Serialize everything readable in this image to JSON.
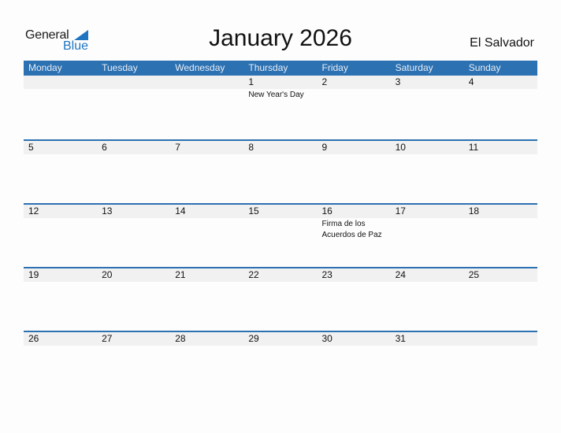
{
  "logo": {
    "line1": "General",
    "line2": "Blue"
  },
  "title": "January 2026",
  "country": "El Salvador",
  "colors": {
    "accent": "#2c71b2",
    "strip": "#f1f1f1",
    "logo_blue": "#1f74c1"
  },
  "weekdays": [
    "Monday",
    "Tuesday",
    "Wednesday",
    "Thursday",
    "Friday",
    "Saturday",
    "Sunday"
  ],
  "weeks": [
    [
      {
        "day": ""
      },
      {
        "day": ""
      },
      {
        "day": ""
      },
      {
        "day": "1",
        "holiday": "New Year's Day"
      },
      {
        "day": "2"
      },
      {
        "day": "3"
      },
      {
        "day": "4"
      }
    ],
    [
      {
        "day": "5"
      },
      {
        "day": "6"
      },
      {
        "day": "7"
      },
      {
        "day": "8"
      },
      {
        "day": "9"
      },
      {
        "day": "10"
      },
      {
        "day": "11"
      }
    ],
    [
      {
        "day": "12"
      },
      {
        "day": "13"
      },
      {
        "day": "14"
      },
      {
        "day": "15"
      },
      {
        "day": "16",
        "holiday": "Firma de los Acuerdos de Paz"
      },
      {
        "day": "17"
      },
      {
        "day": "18"
      }
    ],
    [
      {
        "day": "19"
      },
      {
        "day": "20"
      },
      {
        "day": "21"
      },
      {
        "day": "22"
      },
      {
        "day": "23"
      },
      {
        "day": "24"
      },
      {
        "day": "25"
      }
    ],
    [
      {
        "day": "26"
      },
      {
        "day": "27"
      },
      {
        "day": "28"
      },
      {
        "day": "29"
      },
      {
        "day": "30"
      },
      {
        "day": "31"
      },
      {
        "day": ""
      }
    ]
  ]
}
